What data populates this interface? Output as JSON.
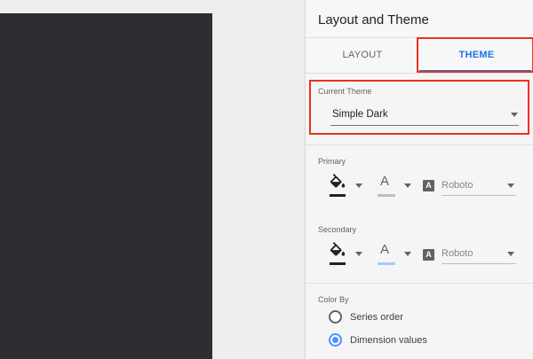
{
  "panel": {
    "title": "Layout and Theme"
  },
  "tabs": [
    {
      "label": "LAYOUT",
      "active": false
    },
    {
      "label": "THEME",
      "active": true
    }
  ],
  "current_theme": {
    "label": "Current Theme",
    "value": "Simple Dark"
  },
  "primary": {
    "label": "Primary",
    "fill_color": "#202124",
    "text_color_swatch": "#bdbdbd",
    "font": "Roboto"
  },
  "secondary": {
    "label": "Secondary",
    "fill_color": "#202124",
    "text_color_swatch": "#a8c7fa",
    "font": "Roboto"
  },
  "color_by": {
    "label": "Color By",
    "options": [
      {
        "label": "Series order",
        "checked": false
      },
      {
        "label": "Dimension values",
        "checked": true
      }
    ]
  },
  "colors": {
    "accent": "#1a73e8",
    "highlight": "#e8321e",
    "radio_checked": "#4d90fe",
    "canvas_dark": "#2d2d32"
  },
  "icons": {
    "fill": "paint-bucket-icon",
    "text": "text-color-icon",
    "font": "font-family-icon",
    "dropdown": "chevron-down-icon"
  }
}
